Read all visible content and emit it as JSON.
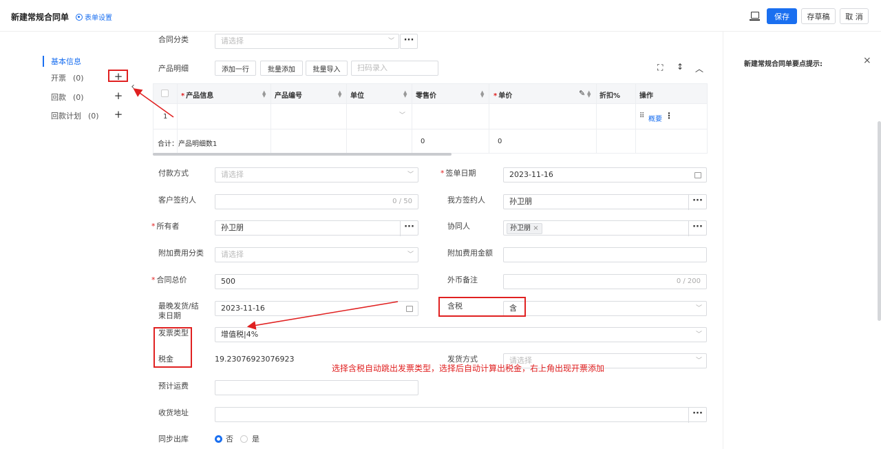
{
  "header": {
    "title": "新建常规合同单",
    "form_settings": "表单设置",
    "save": "保存",
    "draft": "存草稿",
    "cancel": "取 消"
  },
  "sidebar": {
    "items": [
      {
        "label": "基本信息",
        "count": ""
      },
      {
        "label": "开票",
        "count": "(0)"
      },
      {
        "label": "回款",
        "count": "(0)"
      },
      {
        "label": "回款计划",
        "count": "(0)"
      }
    ]
  },
  "form": {
    "contract_category": {
      "label": "合同分类",
      "placeholder": "请选择"
    },
    "product_detail": {
      "label": "产品明细",
      "add_row": "添加一行",
      "batch_add": "批量添加",
      "batch_import": "批量导入",
      "scan_placeholder": "扫码录入"
    },
    "table": {
      "headers": [
        "产品信息",
        "产品编号",
        "单位",
        "零售价",
        "单价",
        "折扣%",
        "操作"
      ],
      "row_index": "1",
      "row_action": "概要",
      "total_label": "合计：产品明细数1",
      "total_retail": "0",
      "total_price": "0"
    },
    "payment_method": {
      "label": "付款方式",
      "placeholder": "请选择"
    },
    "sign_date": {
      "label": "签单日期",
      "value": "2023-11-16"
    },
    "customer_signer": {
      "label": "客户签约人",
      "count": "0 / 50"
    },
    "our_signer": {
      "label": "我方签约人",
      "value": "孙卫朋"
    },
    "owner": {
      "label": "所有者",
      "value": "孙卫朋"
    },
    "collaborator": {
      "label": "协同人",
      "tag": "孙卫朋"
    },
    "extra_fee_category": {
      "label": "附加费用分类",
      "placeholder": "请选择"
    },
    "extra_fee_amount": {
      "label": "附加费用金额"
    },
    "contract_total": {
      "label": "合同总价",
      "value": "500"
    },
    "currency_note": {
      "label": "外币备注",
      "count": "0 / 200"
    },
    "latest_delivery": {
      "label_line1": "最晚发货/结",
      "label_line2": "束日期",
      "value": "2023-11-16"
    },
    "tax_included": {
      "label": "含税",
      "value": "含"
    },
    "invoice_type": {
      "label": "发票类型",
      "value": "增值税|4%"
    },
    "tax": {
      "label": "税金",
      "value": "19.23076923076923"
    },
    "delivery_method": {
      "label": "发货方式",
      "placeholder": "请选择"
    },
    "freight": {
      "label": "预计运费"
    },
    "address": {
      "label": "收货地址"
    },
    "sync_outbound": {
      "label": "同步出库",
      "options": [
        "否",
        "是"
      ],
      "selected": "否"
    }
  },
  "right_panel": {
    "title": "新建常规合同单要点提示:"
  },
  "annotation": {
    "text": "选择含税自动跳出发票类型，选择后自动计算出税金，右上角出现开票添加"
  },
  "colors": {
    "accent": "#1a6ff0",
    "annotation": "#e02020"
  }
}
